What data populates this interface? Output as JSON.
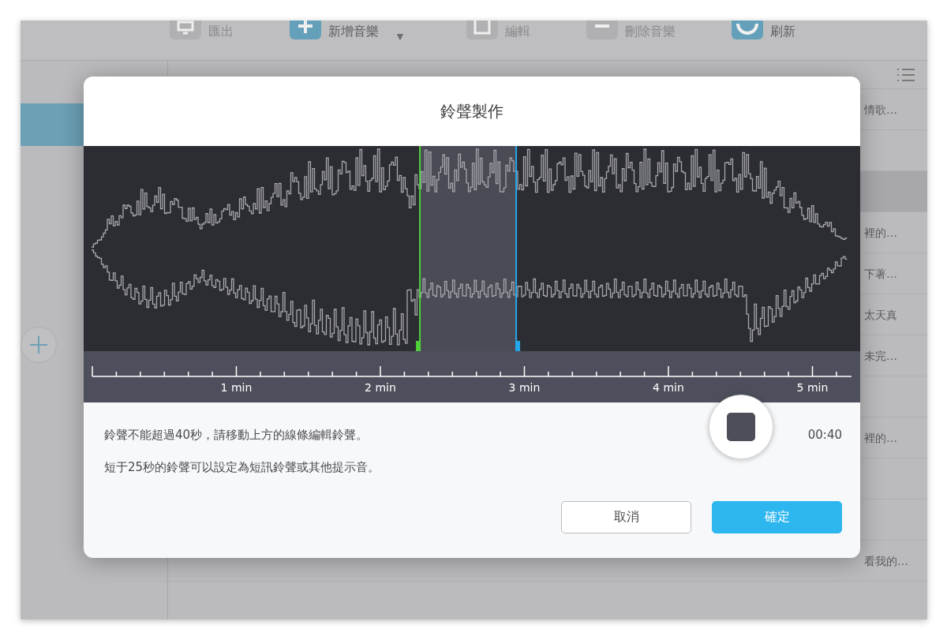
{
  "toolbar": [
    {
      "label": "匯出",
      "kind": "export",
      "disabled": true
    },
    {
      "label": "新增音樂",
      "kind": "add",
      "disabled": false,
      "dropdown": "▼"
    },
    {
      "label": "編輯",
      "kind": "edit",
      "disabled": true
    },
    {
      "label": "刪除音樂",
      "kind": "delete",
      "disabled": true
    },
    {
      "label": "刷新",
      "kind": "refresh",
      "disabled": false
    }
  ],
  "sidebar": {
    "items": [
      {
        "selected": true
      }
    ]
  },
  "list": {
    "rows": [
      {
        "column_3": "情歌…",
        "selected": false
      },
      {
        "column_3": "",
        "selected": false
      },
      {
        "column_3": "",
        "selected": true
      },
      {
        "column_3": "裡的…",
        "selected": false
      },
      {
        "column_3": "下著…",
        "selected": false
      },
      {
        "column_3": "太天真",
        "selected": false
      },
      {
        "column_3": "未完…",
        "selected": false
      },
      {
        "column_3": "",
        "selected": false
      },
      {
        "column_3": "裡的…",
        "selected": false
      },
      {
        "column_3": "",
        "selected": false
      },
      {
        "column_3": "",
        "selected": false
      },
      {
        "column_3": "看我的…",
        "selected": false
      }
    ]
  },
  "dialog": {
    "title": "鈴聲製作",
    "handles": [
      {
        "kind": "start",
        "level": 0.433
      },
      {
        "kind": "end",
        "level": 0.557
      }
    ],
    "timeline": {
      "labels": [
        "1 min",
        "2 min",
        "3 min",
        "4 min",
        "5 min"
      ]
    },
    "notes": [
      "鈴聲不能超過40秒，請移動上方的線條編輯鈴聲。",
      "短于25秒的鈴聲可以設定為短訊鈴聲或其他提示音。"
    ],
    "duration": "00:40",
    "buttons": [
      {
        "label": "取消",
        "kind": "secondary"
      },
      {
        "label": "確定",
        "kind": "primary"
      }
    ]
  }
}
